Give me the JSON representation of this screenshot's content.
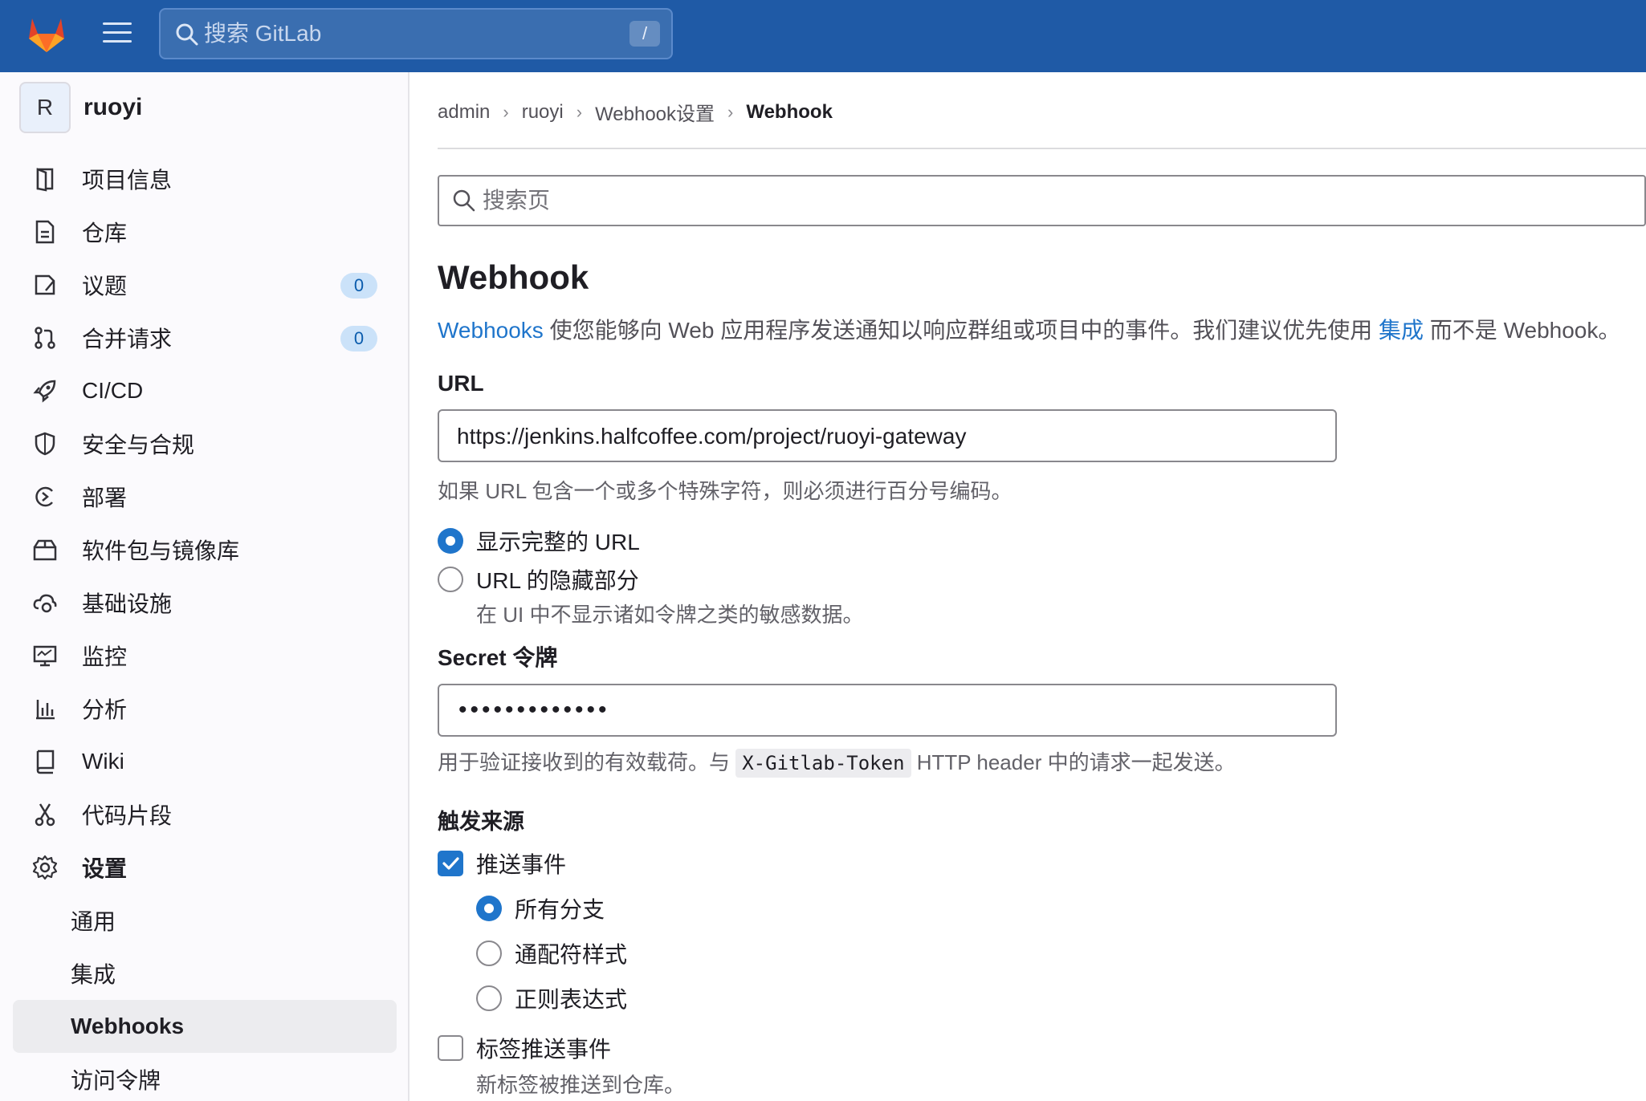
{
  "topbar": {
    "search_placeholder": "搜索 GitLab",
    "shortcut_key": "/",
    "colors": {
      "background": "#1f5aa6",
      "logo_orange": "#fc6d26"
    }
  },
  "sidebar": {
    "project_avatar": "R",
    "project_name": "ruoyi",
    "items": [
      {
        "label": "项目信息",
        "icon": "project-info-icon"
      },
      {
        "label": "仓库",
        "icon": "repository-icon"
      },
      {
        "label": "议题",
        "icon": "issues-icon",
        "badge": "0"
      },
      {
        "label": "合并请求",
        "icon": "merge-request-icon",
        "badge": "0"
      },
      {
        "label": "CI/CD",
        "icon": "rocket-icon"
      },
      {
        "label": "安全与合规",
        "icon": "shield-icon"
      },
      {
        "label": "部署",
        "icon": "deployments-icon"
      },
      {
        "label": "软件包与镜像库",
        "icon": "package-icon"
      },
      {
        "label": "基础设施",
        "icon": "cloud-gear-icon"
      },
      {
        "label": "监控",
        "icon": "monitor-icon"
      },
      {
        "label": "分析",
        "icon": "chart-icon"
      },
      {
        "label": "Wiki",
        "icon": "book-icon"
      },
      {
        "label": "代码片段",
        "icon": "scissors-icon"
      },
      {
        "label": "设置",
        "icon": "settings-icon"
      }
    ],
    "settings_sub": [
      "通用",
      "集成",
      "Webhooks",
      "访问令牌"
    ],
    "active_sub": "Webhooks"
  },
  "breadcrumb": [
    "admin",
    "ruoyi",
    "Webhook设置",
    "Webhook"
  ],
  "page_search": {
    "placeholder": "搜索页"
  },
  "content": {
    "title": "Webhook",
    "desc_link1": "Webhooks",
    "desc_mid": " 使您能够向 Web 应用程序发送通知以响应群组或项目中的事件。我们建议优先使用 ",
    "desc_link2": "集成",
    "desc_end": " 而不是 Webhook。",
    "url_label": "URL",
    "url_value": "https://jenkins.halfcoffee.com/project/ruoyi-gateway",
    "url_help": "如果 URL 包含一个或多个特殊字符，则必须进行百分号编码。",
    "url_display_full": "显示完整的 URL",
    "url_mask": "URL 的隐藏部分",
    "url_mask_help": "在 UI 中不显示诸如令牌之类的敏感数据。",
    "secret_label": "Secret 令牌",
    "secret_value": "•••••••••••••",
    "secret_help_pre": "用于验证接收到的有效载荷。与 ",
    "secret_help_code": "X-Gitlab-Token",
    "secret_help_post": " HTTP header 中的请求一起发送。",
    "trigger_label": "触发来源",
    "push_events": "推送事件",
    "push_all_branches": "所有分支",
    "push_wildcard": "通配符样式",
    "push_regex": "正则表达式",
    "tag_push_events": "标签推送事件",
    "tag_push_help": "新标签被推送到仓库。"
  }
}
